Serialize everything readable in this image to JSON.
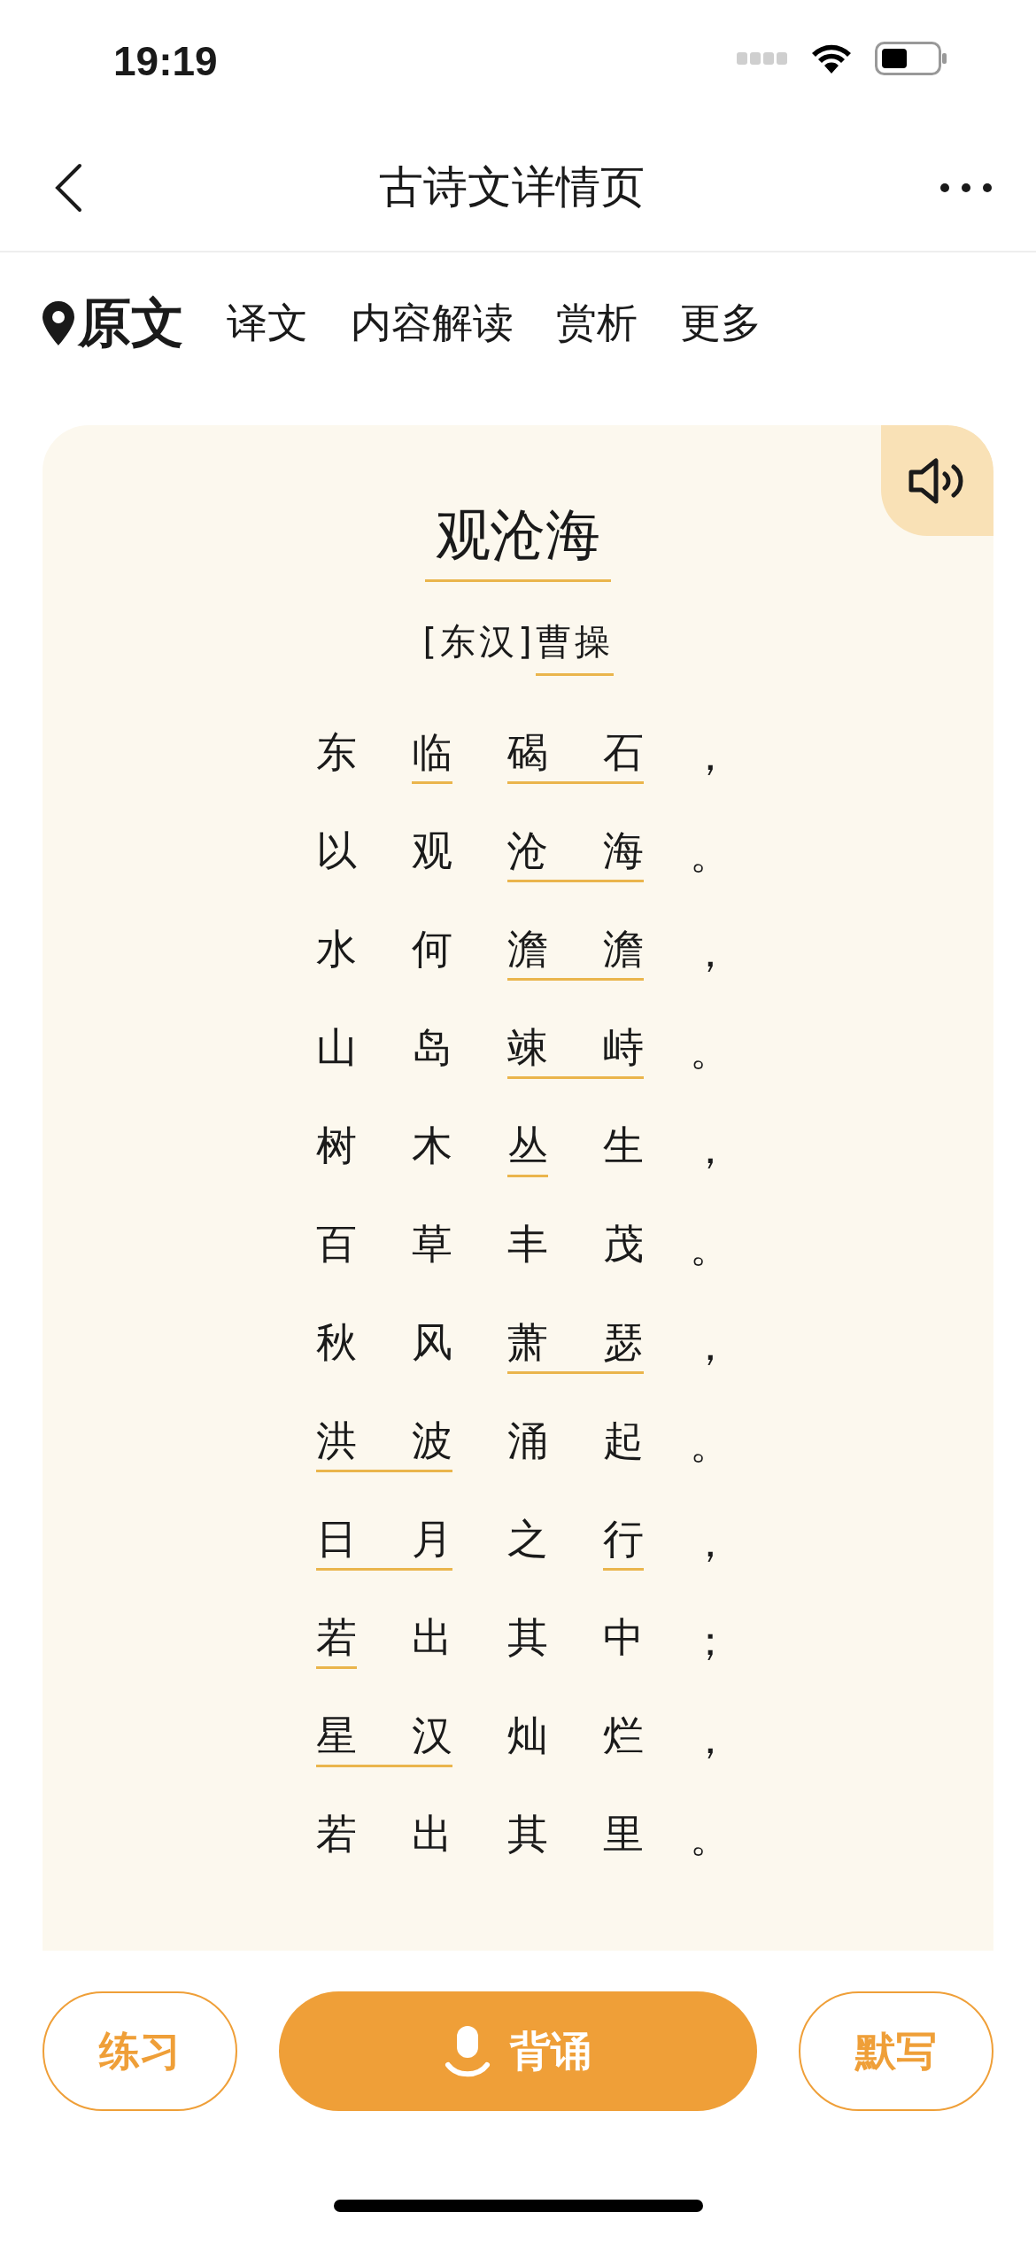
{
  "status_bar": {
    "time": "19:19"
  },
  "nav_bar": {
    "title": "古诗文详情页"
  },
  "tabs": [
    {
      "label": "原文",
      "selected": true
    },
    {
      "label": "译文",
      "selected": false
    },
    {
      "label": "内容解读",
      "selected": false
    },
    {
      "label": "赏析",
      "selected": false
    },
    {
      "label": "更多",
      "selected": false
    }
  ],
  "poem": {
    "title": "观沧海",
    "title_underlined": true,
    "author": [
      {
        "text": "[东汉]",
        "underlined": false
      },
      {
        "text": "曹操",
        "underlined": true
      }
    ],
    "lines": [
      {
        "segments": [
          {
            "text": "东",
            "underlined": false
          },
          {
            "text": "临",
            "underlined": true
          },
          {
            "text": "碣石",
            "underlined": true
          }
        ],
        "punctuation": "，"
      },
      {
        "segments": [
          {
            "text": "以",
            "underlined": false
          },
          {
            "text": "观",
            "underlined": false
          },
          {
            "text": "沧海",
            "underlined": true
          }
        ],
        "punctuation": "。"
      },
      {
        "segments": [
          {
            "text": "水",
            "underlined": false
          },
          {
            "text": "何",
            "underlined": false
          },
          {
            "text": "澹澹",
            "underlined": true
          }
        ],
        "punctuation": "，"
      },
      {
        "segments": [
          {
            "text": "山",
            "underlined": false
          },
          {
            "text": "岛",
            "underlined": false
          },
          {
            "text": "竦峙",
            "underlined": true
          }
        ],
        "punctuation": "。"
      },
      {
        "segments": [
          {
            "text": "树",
            "underlined": false
          },
          {
            "text": "木",
            "underlined": false
          },
          {
            "text": "丛",
            "underlined": true
          },
          {
            "text": "生",
            "underlined": false
          }
        ],
        "punctuation": "，"
      },
      {
        "segments": [
          {
            "text": "百",
            "underlined": false
          },
          {
            "text": "草",
            "underlined": false
          },
          {
            "text": "丰",
            "underlined": false
          },
          {
            "text": "茂",
            "underlined": false
          }
        ],
        "punctuation": "。"
      },
      {
        "segments": [
          {
            "text": "秋",
            "underlined": false
          },
          {
            "text": "风",
            "underlined": false
          },
          {
            "text": "萧瑟",
            "underlined": true
          }
        ],
        "punctuation": "，"
      },
      {
        "segments": [
          {
            "text": "洪波",
            "underlined": true
          },
          {
            "text": "涌",
            "underlined": false
          },
          {
            "text": "起",
            "underlined": false
          }
        ],
        "punctuation": "。"
      },
      {
        "segments": [
          {
            "text": "日月",
            "underlined": true
          },
          {
            "text": "之",
            "underlined": false
          },
          {
            "text": "行",
            "underlined": true
          }
        ],
        "punctuation": "，"
      },
      {
        "segments": [
          {
            "text": "若",
            "underlined": true
          },
          {
            "text": "出",
            "underlined": false
          },
          {
            "text": "其",
            "underlined": false
          },
          {
            "text": "中",
            "underlined": false
          }
        ],
        "punctuation": "；"
      },
      {
        "segments": [
          {
            "text": "星汉",
            "underlined": true
          },
          {
            "text": "灿",
            "underlined": false
          },
          {
            "text": "烂",
            "underlined": false
          }
        ],
        "punctuation": "，"
      },
      {
        "segments": [
          {
            "text": "若",
            "underlined": false
          },
          {
            "text": "出",
            "underlined": false
          },
          {
            "text": "其",
            "underlined": false
          },
          {
            "text": "里",
            "underlined": false
          }
        ],
        "punctuation": "。"
      }
    ]
  },
  "actions": [
    {
      "label": "练习",
      "kind": "outline"
    },
    {
      "label": "背诵",
      "kind": "primary"
    },
    {
      "label": "默写",
      "kind": "outline"
    }
  ]
}
